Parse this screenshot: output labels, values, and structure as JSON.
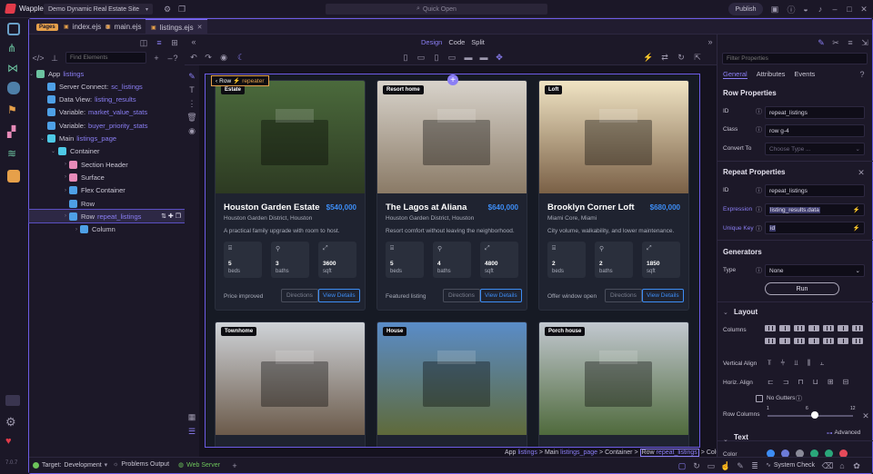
{
  "titlebar": {
    "app": "Wappler",
    "project": "Demo Dynamic Real Estate Site",
    "quick_open": "Quick Open",
    "publish": "Publish"
  },
  "left_strip": {
    "version": "7.0.7"
  },
  "tabs": {
    "pages_badge": "Pages",
    "items": [
      {
        "label": "index.ejs"
      },
      {
        "label": "main.ejs"
      },
      {
        "label": "listings.ejs",
        "active": true
      }
    ]
  },
  "left_panel": {
    "find_placeholder": "Find Elements",
    "tree": [
      {
        "label": "App",
        "link": "listings",
        "depth": 0,
        "icon": "globe-icon",
        "color": "#6cc3a0"
      },
      {
        "label": "Server Connect:",
        "link": "sc_listings",
        "depth": 1,
        "icon": "db-icon",
        "color": "#4ea0e6"
      },
      {
        "label": "Data View:",
        "link": "listing_results",
        "depth": 1,
        "icon": "filter-icon",
        "color": "#4ea0e6"
      },
      {
        "label": "Variable:",
        "link": "market_value_stats",
        "depth": 1,
        "icon": "var-icon",
        "color": "#4ea0e6"
      },
      {
        "label": "Variable:",
        "link": "buyer_priority_stats",
        "depth": 1,
        "icon": "var-icon",
        "color": "#4ea0e6"
      },
      {
        "label": "Main",
        "link": "listings_page",
        "depth": 1,
        "icon": "box-icon",
        "color": "#4ec9e6"
      },
      {
        "label": "Container",
        "link": "",
        "depth": 2,
        "icon": "box-icon",
        "color": "#4ec9e6"
      },
      {
        "label": "Section Header",
        "link": "",
        "depth": 3,
        "icon": "heading-icon",
        "color": "#e68ab8"
      },
      {
        "label": "Surface",
        "link": "",
        "depth": 3,
        "icon": "surface-icon",
        "color": "#e68ab8"
      },
      {
        "label": "Flex Container",
        "link": "",
        "depth": 3,
        "icon": "flex-icon",
        "color": "#4ea0e6"
      },
      {
        "label": "Row",
        "link": "",
        "depth": 3,
        "icon": "row-icon",
        "color": "#4ea0e6"
      },
      {
        "label": "Row",
        "link": "repeat_listings",
        "depth": 3,
        "icon": "row-icon",
        "color": "#4ea0e6",
        "selected": true
      },
      {
        "label": "Column",
        "link": "",
        "depth": 4,
        "icon": "column-icon",
        "color": "#4ea0e6"
      }
    ]
  },
  "editor": {
    "view_modes": [
      "Design",
      "Code",
      "Split"
    ],
    "active_mode": "Design",
    "row_label": "Row",
    "repeater_label": "repeater"
  },
  "cards": [
    {
      "badge": "Estate",
      "title": "Houston Garden Estate",
      "price": "$540,000",
      "location": "Houston Garden District, Houston",
      "desc": "A practical family upgrade with room to host.",
      "beds": "5",
      "baths": "3",
      "sqft": "3600",
      "footer": "Price improved",
      "directions": "Directions",
      "view": "View Details",
      "img_top": "#4b6a3c",
      "img_bot": "#2d3a22"
    },
    {
      "badge": "Resort home",
      "title": "The Lagos at Aliana",
      "price": "$640,000",
      "location": "Houston Garden District, Houston",
      "desc": "Resort comfort without leaving the neighborhood.",
      "beds": "5",
      "baths": "4",
      "sqft": "4800",
      "footer": "Featured listing",
      "directions": "Directions",
      "view": "View Details",
      "img_top": "#d8d3cb",
      "img_bot": "#8a7a66"
    },
    {
      "badge": "Loft",
      "title": "Brooklyn Corner Loft",
      "price": "$680,000",
      "location": "Miami Core, Miami",
      "desc": "City volume, walkability, and lower maintenance.",
      "beds": "2",
      "baths": "2",
      "sqft": "1850",
      "footer": "Offer window open",
      "directions": "Directions",
      "view": "View Details",
      "img_top": "#f0e4c4",
      "img_bot": "#7a6046"
    },
    {
      "badge": "Townhome",
      "title": "",
      "price": "",
      "location": "",
      "desc": "",
      "beds": "",
      "baths": "",
      "sqft": "",
      "footer": "",
      "directions": "",
      "view": "",
      "img_top": "#cfd3d8",
      "img_bot": "#6b5a4a"
    },
    {
      "badge": "House",
      "title": "",
      "price": "",
      "location": "",
      "desc": "",
      "beds": "",
      "baths": "",
      "sqft": "",
      "footer": "",
      "directions": "",
      "view": "",
      "img_top": "#5a8cc8",
      "img_bot": "#5f6a3a"
    },
    {
      "badge": "Porch house",
      "title": "",
      "price": "",
      "location": "",
      "desc": "",
      "beds": "",
      "baths": "",
      "sqft": "",
      "footer": "",
      "directions": "",
      "view": "",
      "img_top": "#c2c8d0",
      "img_bot": "#4f6a3c"
    }
  ],
  "stat_labels": {
    "beds": "beds",
    "baths": "baths",
    "sqft": "sqft"
  },
  "breadcrumb": [
    {
      "label": "App",
      "link": "listings"
    },
    {
      "label": "Main",
      "link": "listings_page"
    },
    {
      "label": "Container",
      "link": ""
    },
    {
      "label": "Row",
      "link": "repeat_listings",
      "boxed": true
    },
    {
      "label": "Column",
      "link": ""
    }
  ],
  "right_panel": {
    "filter_placeholder": "Filter Properties",
    "tabs": [
      "General",
      "Attributes",
      "Events"
    ],
    "active_tab": "General",
    "row_properties": {
      "title": "Row Properties",
      "id_label": "ID",
      "id_value": "repeat_listings",
      "class_label": "Class",
      "class_value": "row g-4",
      "convert_label": "Convert To",
      "convert_placeholder": "Choose Type ..."
    },
    "repeat_properties": {
      "title": "Repeat Properties",
      "id_label": "ID",
      "id_value": "repeat_listings",
      "expr_label": "Expression",
      "expr_value": "listing_results.data",
      "key_label": "Unique Key",
      "key_value": "id"
    },
    "generators": {
      "title": "Generators",
      "type_label": "Type",
      "type_value": "None",
      "run_label": "Run"
    },
    "layout": {
      "title": "Layout",
      "columns_label": "Columns",
      "valign_label": "Vertical Align",
      "halign_label": "Horiz. Align",
      "no_gutters_label": "No Gutters",
      "row_columns_label": "Row Columns",
      "slider_min": "1",
      "slider_mid": "6",
      "slider_max": "12",
      "advanced_label": "Advanced"
    },
    "text": {
      "title": "Text",
      "color_label": "Color",
      "swatches": [
        "#3d8df5",
        "#6c7bd8",
        "#8a8a98",
        "#2aa67a",
        "#2aa67a",
        "#e64a5a"
      ]
    }
  },
  "statusbar": {
    "target_label": "Target:",
    "target_value": "Development",
    "problems": "Problems",
    "output": "Output",
    "web_server": "Web Server",
    "system_check": "System Check"
  }
}
